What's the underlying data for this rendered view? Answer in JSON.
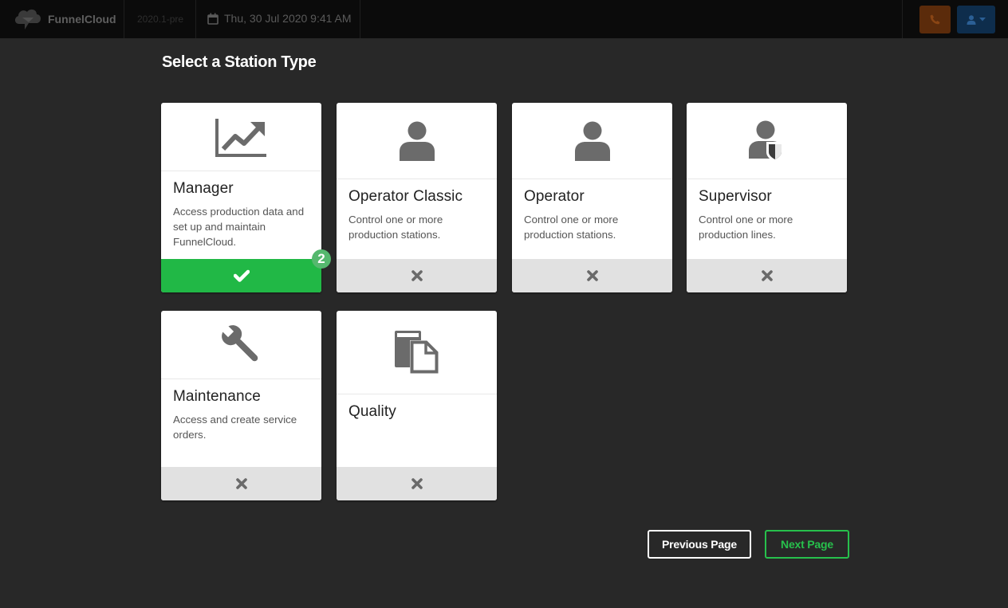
{
  "app": {
    "name": "FunnelCloud",
    "version": "2020.1-pre",
    "datetime": "Thu, 30 Jul 2020 9:41 AM"
  },
  "page": {
    "title": "Select a Station Type"
  },
  "stations": [
    {
      "title": "Manager",
      "description": "Access production data and set up and maintain FunnelCloud.",
      "icon": "line-chart-icon",
      "selected": true
    },
    {
      "title": "Operator Classic",
      "description": "Control one or more production stations.",
      "icon": "user-icon",
      "selected": false
    },
    {
      "title": "Operator",
      "description": "Control one or more production stations.",
      "icon": "user-icon",
      "selected": false
    },
    {
      "title": "Supervisor",
      "description": "Control one or more production lines.",
      "icon": "user-shield-icon",
      "selected": false
    },
    {
      "title": "Maintenance",
      "description": "Access and create service orders.",
      "icon": "wrench-icon",
      "selected": false
    },
    {
      "title": "Quality",
      "description": "",
      "icon": "documents-icon",
      "selected": false
    }
  ],
  "badge": "2",
  "buttons": {
    "previous": "Previous Page",
    "next": "Next Page"
  },
  "colors": {
    "background": "#282828",
    "selected": "#21b846",
    "next_accent": "#27c04c"
  }
}
